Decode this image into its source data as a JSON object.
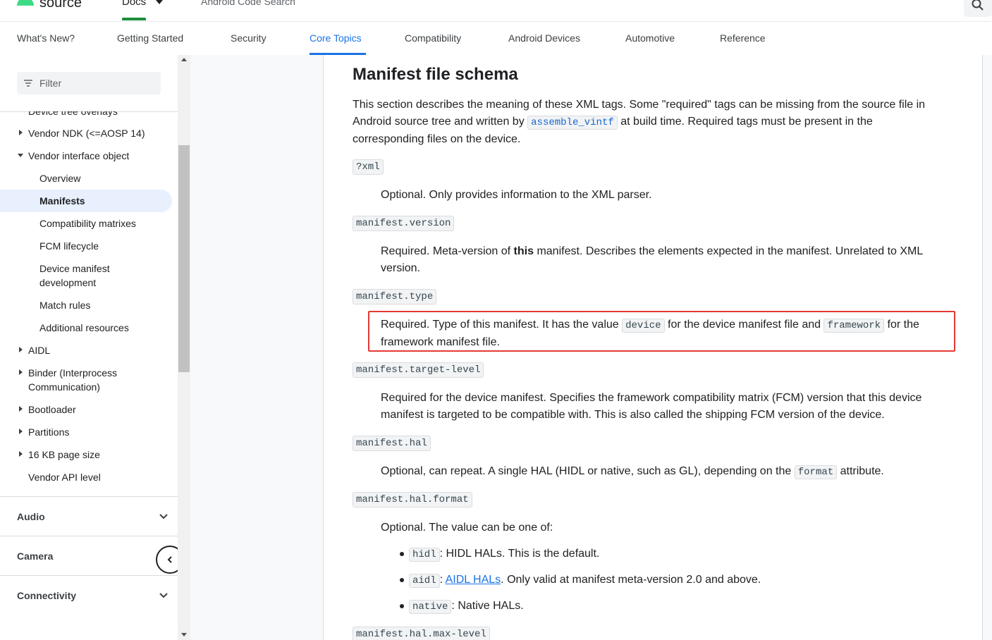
{
  "topbar": {
    "logo_text": "source",
    "docs_label": "Docs",
    "code_search_label": "Android Code Search"
  },
  "tabs": [
    "What's New?",
    "Getting Started",
    "Security",
    "Core Topics",
    "Compatibility",
    "Android Devices",
    "Automotive",
    "Reference"
  ],
  "active_tab": "Core Topics",
  "sidebar": {
    "filter_placeholder": "Filter",
    "partial_item": "Device tree overlays",
    "items": [
      {
        "label": "Vendor NDK (<=AOSP 14)"
      },
      {
        "label": "Vendor interface object"
      },
      {
        "label": "Overview"
      },
      {
        "label": "Manifests"
      },
      {
        "label": "Compatibility matrixes"
      },
      {
        "label": "FCM lifecycle"
      },
      {
        "label": "Device manifest"
      },
      {
        "label": "development"
      },
      {
        "label": "Match rules"
      },
      {
        "label": "Additional resources"
      },
      {
        "label": "AIDL"
      },
      {
        "label": "Binder (Interprocess"
      },
      {
        "label": "Communication)"
      },
      {
        "label": "Bootloader"
      },
      {
        "label": "Partitions"
      },
      {
        "label": "16 KB page size"
      },
      {
        "label": "Vendor API level"
      }
    ],
    "sections": [
      "Audio",
      "Camera",
      "Connectivity"
    ]
  },
  "article": {
    "heading": "Manifest file schema",
    "intro": {
      "line1": "This section describes the meaning of these XML tags. Some \"required\" tags can be missing from the source file in",
      "line2_pre": "Android source tree and written by",
      "line2_code": "assemble_vintf",
      "line2_post": "at build time. Required tags must be present in the",
      "line3": "corresponding files on the device."
    },
    "tags": [
      {
        "tag": "?xml",
        "desc": "Optional. Only provides information to the XML parser."
      },
      {
        "tag": "manifest.version",
        "desc_pre": "Required. Meta-version of",
        "desc_bold": "this",
        "desc_post": "manifest. Describes the elements expected in the manifest. Unrelated to XML",
        "desc_line2": "version."
      },
      {
        "tag": "manifest.type",
        "desc_pre": "Required. Type of this manifest. It has the value",
        "code1": "device",
        "desc_mid": "for the device manifest file and",
        "code2": "framework",
        "desc_post": "for the",
        "desc_line2": "framework manifest file."
      },
      {
        "tag": "manifest.target-level",
        "desc_line1": "Required for the device manifest. Specifies the framework compatibility matrix (FCM) version that this device",
        "desc_line2": "manifest is targeted to be compatible with. This is also called the shipping FCM version of the device."
      },
      {
        "tag": "manifest.hal",
        "desc_pre": "Optional, can repeat. A single HAL (HIDL or native, such as GL), depending on the",
        "code1": "format",
        "desc_post": "attribute."
      },
      {
        "tag": "manifest.hal.format",
        "desc": "Optional. The value can be one of:"
      },
      {
        "tag": "manifest.hal.max-level"
      }
    ],
    "format_options": [
      {
        "code": "hidl",
        "text": ": HIDL HALs. This is the default."
      },
      {
        "code": "aidl",
        "link": "AIDL HALs",
        "text": ". Only valid at manifest meta-version 2.0 and above."
      },
      {
        "code": "native",
        "text": ": Native HALs."
      }
    ]
  }
}
